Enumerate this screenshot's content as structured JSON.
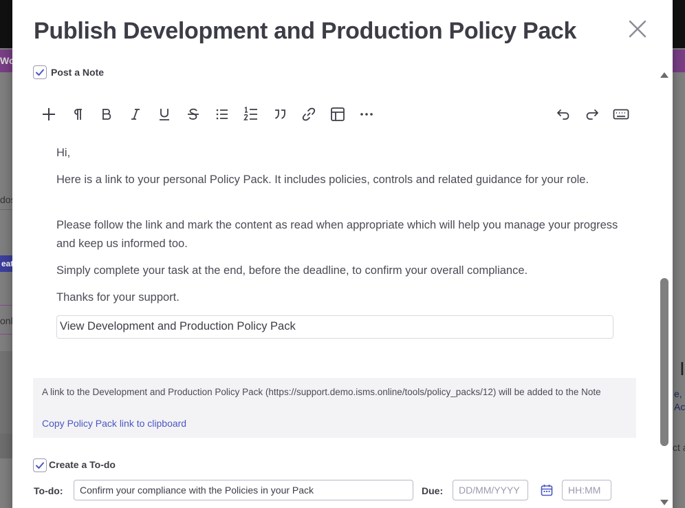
{
  "background": {
    "frag_wo": "Wo",
    "frag_dos": "dos",
    "frag_eat": "eat",
    "frag_only": "only",
    "frag_i": "I",
    "frag_eh": "e, H",
    "frag_act": "Act",
    "frag_cta": "ct a"
  },
  "modal": {
    "title": "Publish Development and Production Policy Pack"
  },
  "post_note": {
    "label": "Post a Note",
    "checked": true
  },
  "toolbar": {
    "icons": [
      "plus-icon",
      "paragraph-icon",
      "bold-icon",
      "italic-icon",
      "underline-icon",
      "strikethrough-icon",
      "bullet-list-icon",
      "numbered-list-icon",
      "quote-icon",
      "link-icon",
      "table-icon",
      "more-icon",
      "undo-icon",
      "redo-icon",
      "keyboard-icon"
    ]
  },
  "editor": {
    "greeting": "Hi,",
    "para1": "Here is a link to your personal Policy Pack. It includes policies, controls and related guidance for your role.",
    "para2": "Please follow the link and mark the content as read when appropriate which will help you manage your progress and keep us informed too.",
    "para3": "Simply complete your task at the end, before the deadline, to confirm your overall compliance.",
    "para4": "Thanks for your support.",
    "link_text": "View Development and Production Policy Pack"
  },
  "info": {
    "text": "A link to the Development and Production Policy Pack (https://support.demo.isms.online/tools/policy_packs/12) will be added to the Note",
    "copy_link": "Copy Policy Pack link to clipboard"
  },
  "todo": {
    "checkbox_label": "Create a To-do",
    "checked": true,
    "todo_label": "To-do:",
    "todo_value": "Confirm your compliance with the Policies in your Pack",
    "due_label": "Due:",
    "date_placeholder": "DD/MM/YYYY",
    "time_placeholder": "HH:MM"
  },
  "colors": {
    "accent": "#4a56c4",
    "title": "#3c3d46",
    "body_text": "#4a4b55",
    "info_bg": "#f3f3f5"
  }
}
